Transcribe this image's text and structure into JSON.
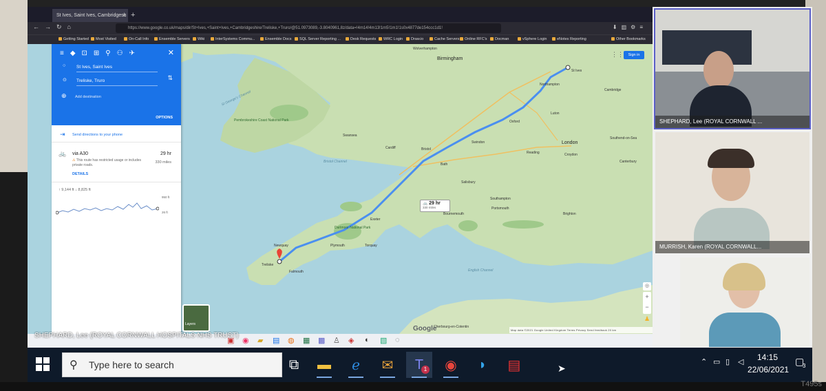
{
  "browser": {
    "tab_title": "St Ives, Saint Ives, Cambridgesh",
    "url": "https://www.google.co.uk/maps/dir/St+Ives,+Saint+Ives,+Cambridgeshire/Treliske,+Truro/@51.0973089,-3.8040961,8z/data=!4m14!4m13!1m5!1m1!1s0x4877de154ccc1d1!",
    "bookmarks": [
      "Getting Started",
      "Most Visited",
      "On-Call Info",
      "Ensemble Servers",
      "Wiki",
      "InterSystems Commu...",
      "Ensemble Docs",
      "SQL Server Reporting ...",
      "Desk Requests",
      "WRC Login",
      "Draw.io",
      "Cache Servers",
      "Online RFC's",
      "Docman",
      "vSphere Login",
      "eNotes Reporting",
      "Other Bookmarks"
    ]
  },
  "directions": {
    "origin": "St Ives, Saint Ives",
    "destination": "Treliske, Truro",
    "add_destination": "Add destination",
    "options": "OPTIONS",
    "send": "Send directions to your phone",
    "route_name": "via A30",
    "duration": "29 hr",
    "distance": "330 miles",
    "warning": "This route has restricted usage or includes private roads.",
    "details": "DETAILS",
    "elevation": "↑ 9,144 ft  ↓ 8,825 ft",
    "elev_high": "950 ft",
    "elev_low": "26 ft"
  },
  "map": {
    "sign_in": "Sign in",
    "card_time": "29 hr",
    "card_dist": "330 miles",
    "layers": "Layers",
    "logo": "Google",
    "footer": "Map data ©2021 Google  United Kingdom  Terms  Privacy  Send feedback  20 km",
    "labels": {
      "birmingham": "Birmingham",
      "london": "London",
      "st_ives": "St Ives",
      "treliske": "Treliske",
      "plymouth": "Plymouth",
      "exeter": "Exeter",
      "bristol": "Bristol",
      "cardiff": "Cardiff",
      "swansea": "Swansea",
      "oxford": "Oxford",
      "cambridge": "Cambridge",
      "southampton": "Southampton",
      "brighton": "Brighton",
      "bournemouth": "Bournemouth",
      "bristol_channel": "Bristol Channel",
      "english_channel": "English Channel",
      "st_georges": "St George's Channel",
      "croydon": "Croydon",
      "reading": "Reading",
      "pembrokeshire": "Pembrokeshire Coast National Park",
      "cherbourg": "Cherbourg-en-Cotentin",
      "newquay": "Newquay",
      "falmouth": "Falmouth",
      "torquay": "Torquay",
      "dartmoor": "Dartmoor National Park",
      "salisbury": "Salisbury",
      "portsmouth": "Portsmouth",
      "bath": "Bath",
      "swindon": "Swindon",
      "northampton": "Northampton",
      "luton": "Luton",
      "southend": "Southend-on-Sea",
      "canterbury": "Canterbury",
      "wolverhampton": "Wolverhampton"
    }
  },
  "meeting": {
    "participants": [
      {
        "name": "SHEPHARD, Lee (ROYAL CORNWALL ..."
      },
      {
        "name": "MURRISH, Karen (ROYAL CORNWALL..."
      },
      {
        "name": ""
      }
    ],
    "presenter": "SHEPHARD, Lee (ROYAL CORNWALL HOSPITALS NHS TRUST)"
  },
  "taskbar": {
    "search_placeholder": "Type here to search",
    "time": "14:15",
    "date": "22/06/2021",
    "notifications": "3",
    "teams_badge": "1"
  },
  "device_brand": "T495s",
  "colors": {
    "accent": "#1a73e8",
    "route": "#4a8ff0",
    "taskbar": "#0e1a2a",
    "teams": "#5b5fc7"
  }
}
